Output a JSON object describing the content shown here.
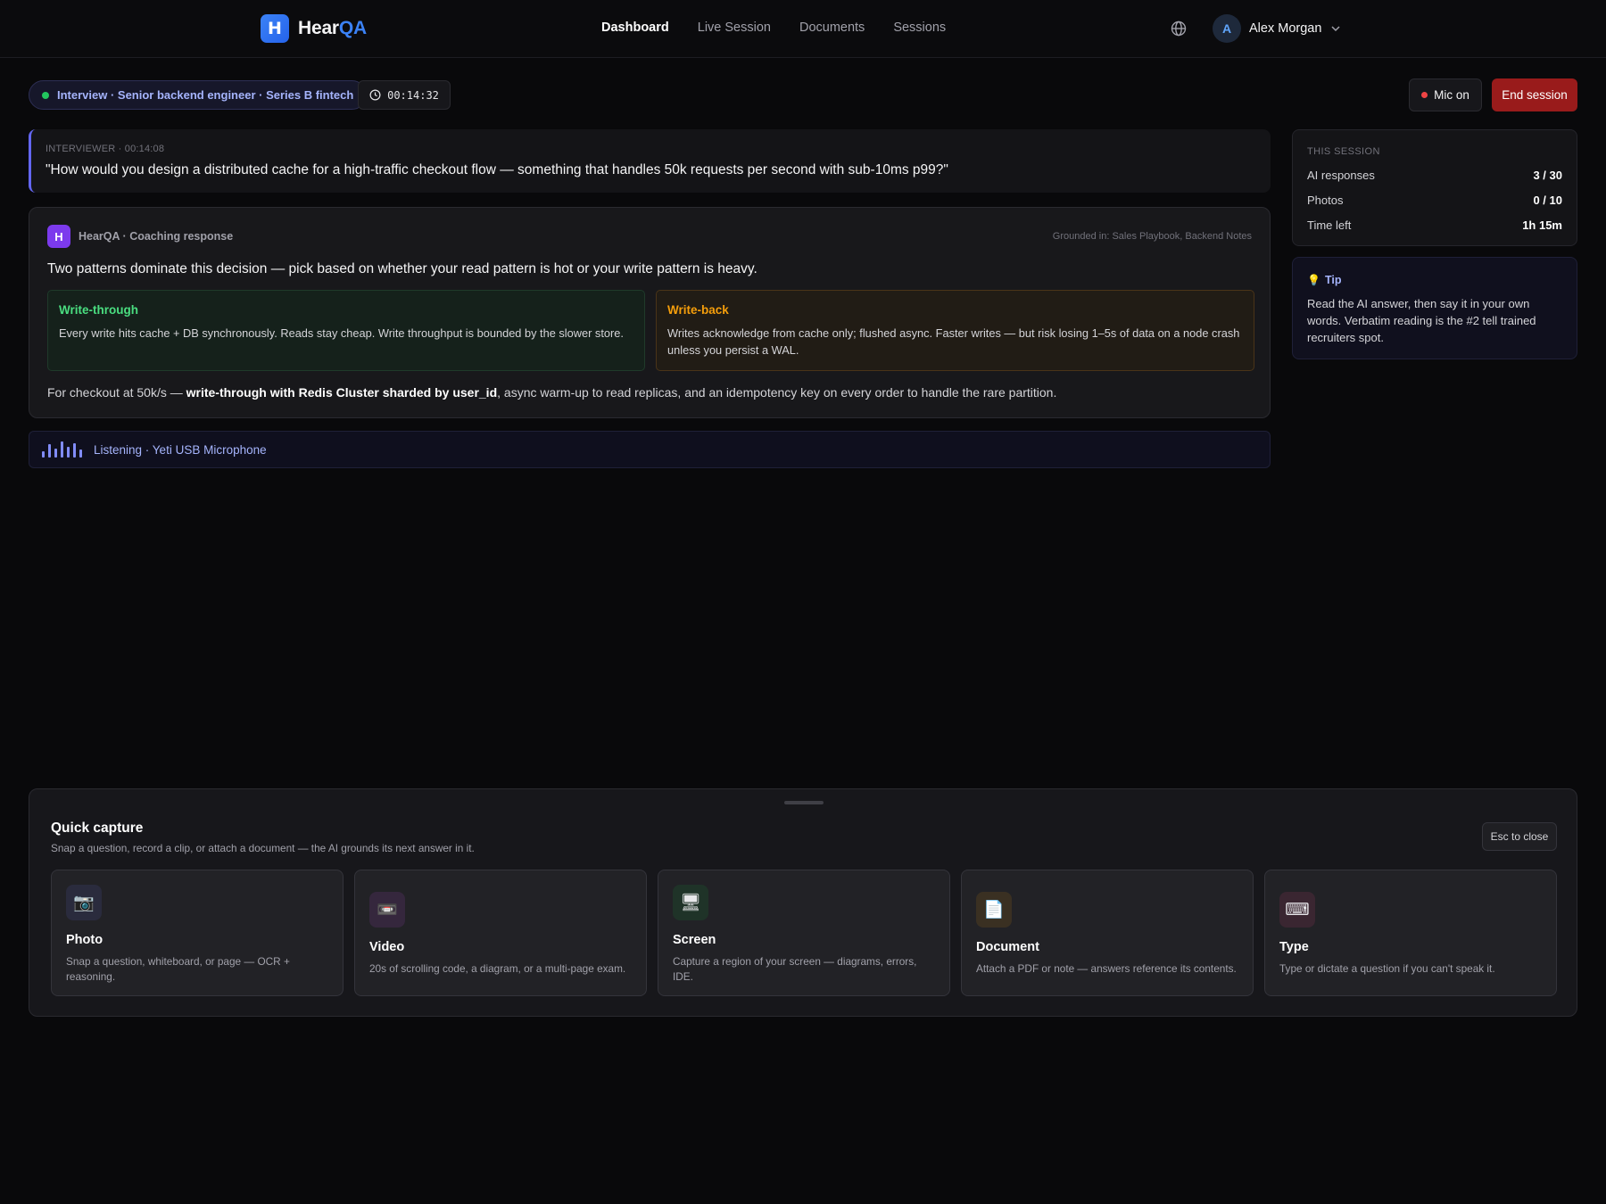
{
  "app": {
    "logo_mark": "H",
    "name_part1": "Hear",
    "name_part2": "QA",
    "brand_color": "#3b82f6"
  },
  "nav": {
    "items": [
      {
        "label": "Dashboard",
        "active": true
      },
      {
        "label": "Live Session",
        "active": false
      },
      {
        "label": "Documents",
        "active": false
      },
      {
        "label": "Sessions",
        "active": false
      }
    ]
  },
  "user": {
    "initial": "A",
    "name": "Alex Morgan",
    "icon": "globe-icon"
  },
  "session": {
    "label": "Interview · Senior backend engineer · Series B fintech",
    "timer": "00:14:32",
    "mic_label": "Mic on",
    "end_label": "End session"
  },
  "question": {
    "meta": "INTERVIEWER · 00:14:08",
    "text": "\"How would you design a distributed cache for a high-traffic checkout flow — something that handles 50k requests per second with sub-10ms p99?\""
  },
  "coaching": {
    "mark": "H",
    "title": "HearQA · Coaching response",
    "grounded": "Grounded in: Sales Playbook, Backend Notes",
    "lead": "Two patterns dominate this decision — pick based on whether your read pattern is hot or your write pattern is heavy.",
    "options": [
      {
        "title": "Write-through",
        "body": "Every write hits cache + DB synchronously. Reads stay cheap. Write throughput is bounded by the slower store."
      },
      {
        "title": "Write-back",
        "body": "Writes acknowledge from cache only; flushed async. Faster writes — but risk losing 1–5s of data on a node crash unless you persist a WAL."
      }
    ],
    "rec_pre": "For checkout at 50k/s — ",
    "rec_bold": "write-through with Redis Cluster sharded by user_id",
    "rec_post": ", async warm-up to read replicas, and an idempotency key on every order to handle the rare partition."
  },
  "listening": {
    "text": "Listening · Yeti USB Microphone"
  },
  "stats": {
    "title": "THIS SESSION",
    "rows": [
      {
        "label": "AI responses",
        "value": "3 / 30"
      },
      {
        "label": "Photos",
        "value": "0 / 10"
      },
      {
        "label": "Time left",
        "value": "1h 15m"
      }
    ]
  },
  "tip": {
    "title": "Tip",
    "body": "Read the AI answer, then say it in your own words. Verbatim reading is the #2 tell trained recruiters spot."
  },
  "quick_capture": {
    "title": "Quick capture",
    "subtitle": "Snap a question, record a clip, or attach a document — the AI grounds its next answer in it.",
    "esc_label": "Esc to close",
    "cards": [
      {
        "icon": "camera-icon",
        "glyph": "📷",
        "title": "Photo",
        "body": "Snap a question, whiteboard, or page — OCR + reasoning.",
        "bg": "#2a2b3d"
      },
      {
        "icon": "video-icon",
        "glyph": "📼",
        "title": "Video",
        "body": "20s of scrolling code, a diagram, or a multi-page exam.",
        "bg": "#35273d"
      },
      {
        "icon": "screen-icon",
        "glyph": "🖥",
        "title": "Screen",
        "body": "Capture a region of your screen — diagrams, errors, IDE.",
        "bg": "#1f3328"
      },
      {
        "icon": "document-icon",
        "glyph": "📄",
        "title": "Document",
        "body": "Attach a PDF or note — answers reference its contents.",
        "bg": "#3a3022"
      },
      {
        "icon": "keyboard-icon",
        "glyph": "⌨",
        "title": "Type",
        "body": "Type or dictate a question if you can't speak it.",
        "bg": "#3a2631"
      }
    ]
  }
}
